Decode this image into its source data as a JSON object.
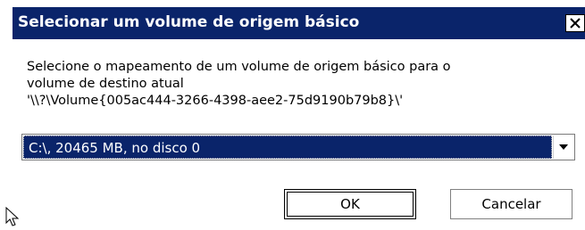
{
  "dialog": {
    "title": "Selecionar um volume de origem básico",
    "description": [
      "Selecione o mapeamento de um volume de origem básico para o",
      "volume de destino atual",
      "'\\\\?\\Volume{005ac444-3266-4398-aee2-75d9190b79b8}\\'"
    ],
    "volume_select": {
      "selected": "C:\\, 20465 MB, no disco 0"
    },
    "buttons": {
      "ok": "OK",
      "cancel": "Cancelar"
    }
  },
  "icons": {
    "close": "close-icon",
    "dropdown": "chevron-down-icon",
    "cursor": "mouse-cursor-icon"
  },
  "colors": {
    "titlebar": "#0a246a",
    "selection": "#0a246a",
    "title_text": "#ffffff"
  }
}
